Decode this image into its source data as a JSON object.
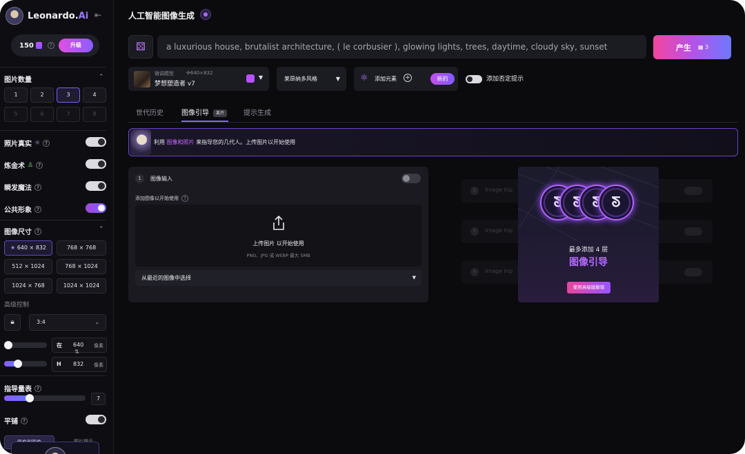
{
  "sidebar": {
    "brand_name": "Leonardo.",
    "brand_ai": "Ai",
    "tokens": "150",
    "upgrade_label": "升级",
    "image_count": {
      "title": "图片数量",
      "options": [
        "1",
        "2",
        "3",
        "4",
        "5",
        "6",
        "7",
        "8"
      ],
      "selected": "3"
    },
    "toggles": [
      {
        "label": "照片真实",
        "state": "off"
      },
      {
        "label": "炼金术",
        "state": "off"
      },
      {
        "label": "瞬发魔法",
        "state": "off"
      },
      {
        "label": "公共形象",
        "state": "on"
      }
    ],
    "image_size": {
      "title": "图像尺寸",
      "options": [
        "640 × 832",
        "768 × 768",
        "512 × 1024",
        "768 × 1024",
        "1024 × 768",
        "1024 × 1024"
      ],
      "selected": "640 × 832"
    },
    "advanced_label": "高级控制",
    "ratio": "3:4",
    "width": {
      "key": "在",
      "value": "640",
      "unit": "像素"
    },
    "height": {
      "key": "H",
      "value": "832",
      "unit": "像素"
    },
    "guidance": {
      "title": "指导量表",
      "value": "7"
    },
    "tiling": {
      "title": "平铺",
      "state": "off"
    },
    "bottom_tabs": [
      "图像到图像",
      "图片提示"
    ]
  },
  "header": {
    "title": "人工智能图像生成"
  },
  "prompt": {
    "text": "a luxurious house, brutalist architecture, ( le corbusier ), glowing lights, trees, daytime, cloudy sky, sunset",
    "generate_label": "产生",
    "generate_cost": "3"
  },
  "model": {
    "sub_label": "微调模型",
    "dims": "640×832",
    "name": "梦想塑造者 v7"
  },
  "style": {
    "value": "莱昂纳多风格"
  },
  "elements": {
    "label": "添加元素",
    "new_badge": "新的"
  },
  "negative_prompt": {
    "label": "添加否定提示"
  },
  "tabs": [
    {
      "label": "世代历史"
    },
    {
      "label": "图像引导",
      "badge": "离开"
    },
    {
      "label": "提示生成"
    }
  ],
  "banner": {
    "prefix": "利用",
    "highlight": "图像和照片",
    "suffix": "来指导您的几代人。上传图片以开始使用"
  },
  "image_input": {
    "number": "1",
    "title": "图像输入",
    "subtitle": "添加图像以开始使用",
    "upload_title": "上传图片 以开始使用",
    "upload_hint": "PNG、JPG 或 WEBP 最大 5MB",
    "recent_label": "从最近的图像中选择"
  },
  "ghost_rows": [
    {
      "number": "2",
      "label": "Image Inp"
    },
    {
      "number": "3",
      "label": "Image Inp"
    },
    {
      "number": "4",
      "label": "Image Inp"
    }
  ],
  "promo": {
    "line1": "最多添加 4 层",
    "line2": "图像引导",
    "button": "使用高级版解锁"
  },
  "colors": {
    "accent": "#8b5cff",
    "highlight": "#c66bff",
    "generate_gradient_start": "#f2459f",
    "generate_gradient_end": "#6d78ff"
  }
}
